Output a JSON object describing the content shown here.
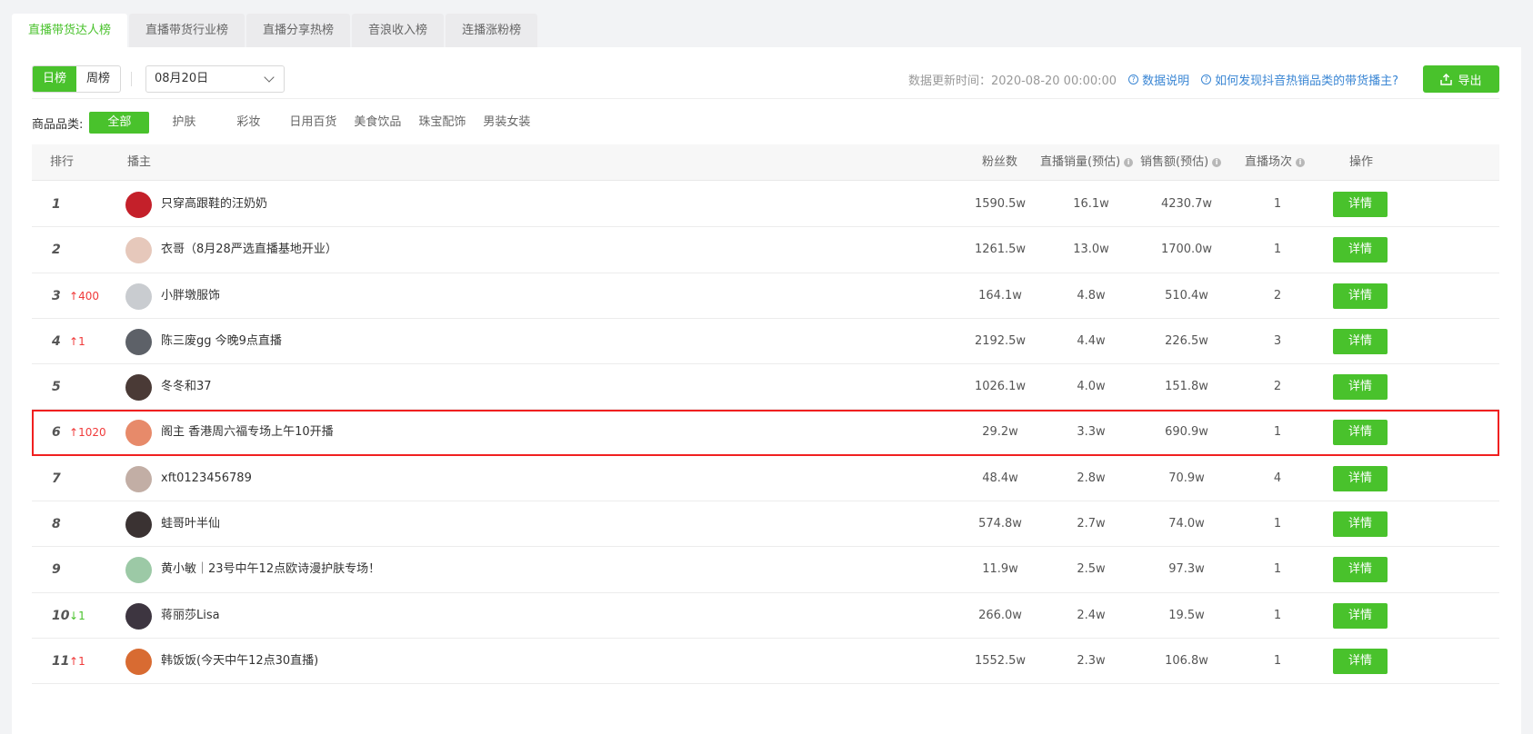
{
  "tabs": [
    {
      "label": "直播带货达人榜",
      "active": true
    },
    {
      "label": "直播带货行业榜",
      "active": false
    },
    {
      "label": "直播分享热榜",
      "active": false
    },
    {
      "label": "音浪收入榜",
      "active": false
    },
    {
      "label": "连播涨粉榜",
      "active": false
    }
  ],
  "toolbar": {
    "period_options": [
      {
        "label": "日榜",
        "active": true
      },
      {
        "label": "周榜",
        "active": false
      }
    ],
    "date_value": "08月20日",
    "update_time": "数据更新时间：2020-08-20 00:00:00",
    "data_explain_label": "数据说明",
    "how_to_label": "如何发现抖音热销品类的带货播主?",
    "export_label": "导出"
  },
  "categories": {
    "label": "商品品类:",
    "items": [
      "全部",
      "护肤",
      "彩妆",
      "日用百货",
      "美食饮品",
      "珠宝配饰",
      "男装女装"
    ],
    "active_index": 0
  },
  "table": {
    "headers": {
      "rank": "排行",
      "streamer": "播主",
      "fans": "粉丝数",
      "sales": "直播销量(预估)",
      "amount": "销售额(预估)",
      "sessions": "直播场次",
      "action": "操作"
    },
    "detail_label": "详情",
    "rows": [
      {
        "rank": "1",
        "delta": "",
        "delta_dir": "",
        "name": "只穿高跟鞋的汪奶奶",
        "fans": "1590.5w",
        "sales": "16.1w",
        "amount": "4230.7w",
        "sessions": "1",
        "avatar_color": "#c4202a",
        "highlight": false
      },
      {
        "rank": "2",
        "delta": "",
        "delta_dir": "",
        "name": "衣哥（8月28严选直播基地开业）",
        "fans": "1261.5w",
        "sales": "13.0w",
        "amount": "1700.0w",
        "sessions": "1",
        "avatar_color": "#e6c8bb",
        "highlight": false
      },
      {
        "rank": "3",
        "delta": "400",
        "delta_dir": "up",
        "name": "小胖墩服饰",
        "fans": "164.1w",
        "sales": "4.8w",
        "amount": "510.4w",
        "sessions": "2",
        "avatar_color": "#c9ccd0",
        "highlight": false
      },
      {
        "rank": "4",
        "delta": "1",
        "delta_dir": "up",
        "name": "陈三废gg 今晚9点直播",
        "fans": "2192.5w",
        "sales": "4.4w",
        "amount": "226.5w",
        "sessions": "3",
        "avatar_color": "#5d6168",
        "highlight": false
      },
      {
        "rank": "5",
        "delta": "",
        "delta_dir": "",
        "name": "冬冬和37",
        "fans": "1026.1w",
        "sales": "4.0w",
        "amount": "151.8w",
        "sessions": "2",
        "avatar_color": "#4a3a36",
        "highlight": false
      },
      {
        "rank": "6",
        "delta": "1020",
        "delta_dir": "up",
        "name": "阁主 香港周六福专场上午10开播",
        "fans": "29.2w",
        "sales": "3.3w",
        "amount": "690.9w",
        "sessions": "1",
        "avatar_color": "#e78a6a",
        "highlight": true
      },
      {
        "rank": "7",
        "delta": "",
        "delta_dir": "",
        "name": "xft0123456789",
        "fans": "48.4w",
        "sales": "2.8w",
        "amount": "70.9w",
        "sessions": "4",
        "avatar_color": "#c2aea5",
        "highlight": false
      },
      {
        "rank": "8",
        "delta": "",
        "delta_dir": "",
        "name": "蛙哥叶半仙",
        "fans": "574.8w",
        "sales": "2.7w",
        "amount": "74.0w",
        "sessions": "1",
        "avatar_color": "#3a3232",
        "highlight": false
      },
      {
        "rank": "9",
        "delta": "",
        "delta_dir": "",
        "name": "黄小敏｜23号中午12点欧诗漫护肤专场！",
        "fans": "11.9w",
        "sales": "2.5w",
        "amount": "97.3w",
        "sessions": "1",
        "avatar_color": "#9cc9a6",
        "highlight": false
      },
      {
        "rank": "10",
        "delta": "1",
        "delta_dir": "down",
        "name": "蒋丽莎Lisa",
        "fans": "266.0w",
        "sales": "2.4w",
        "amount": "19.5w",
        "sessions": "1",
        "avatar_color": "#3d3540",
        "highlight": false
      },
      {
        "rank": "11",
        "delta": "1",
        "delta_dir": "up",
        "name": "韩饭饭(今天中午12点30直播)",
        "fans": "1552.5w",
        "sales": "2.3w",
        "amount": "106.8w",
        "sessions": "1",
        "avatar_color": "#d86b32",
        "highlight": false
      }
    ]
  },
  "colors": {
    "accent": "#49c22c",
    "up": "#f03a3a",
    "down": "#49c22c",
    "highlight_border": "#f02020",
    "link": "#3a86d4"
  }
}
